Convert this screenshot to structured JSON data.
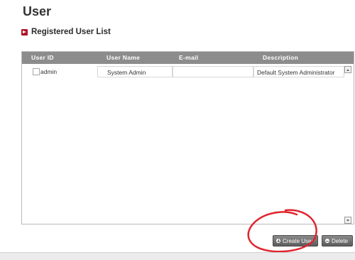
{
  "page": {
    "title": "User"
  },
  "section": {
    "title": "Registered User List"
  },
  "table": {
    "headers": [
      "User ID",
      "User Name",
      "E-mail",
      "Description"
    ],
    "rows": [
      {
        "user_id": "admin",
        "user_name": "System Admin",
        "email": "",
        "description": "Default System Administrator"
      }
    ]
  },
  "actions": {
    "create_label": "Create User",
    "delete_label": "Delete"
  },
  "colors": {
    "header_bg": "#8c8c8c",
    "bullet": "#b0132b",
    "annotation": "#e0242e",
    "button_bg": "#5c5c5c"
  },
  "icons": [
    "bullet-arrow-icon",
    "plus-icon",
    "minus-icon",
    "scroll-up-icon",
    "scroll-down-icon"
  ]
}
